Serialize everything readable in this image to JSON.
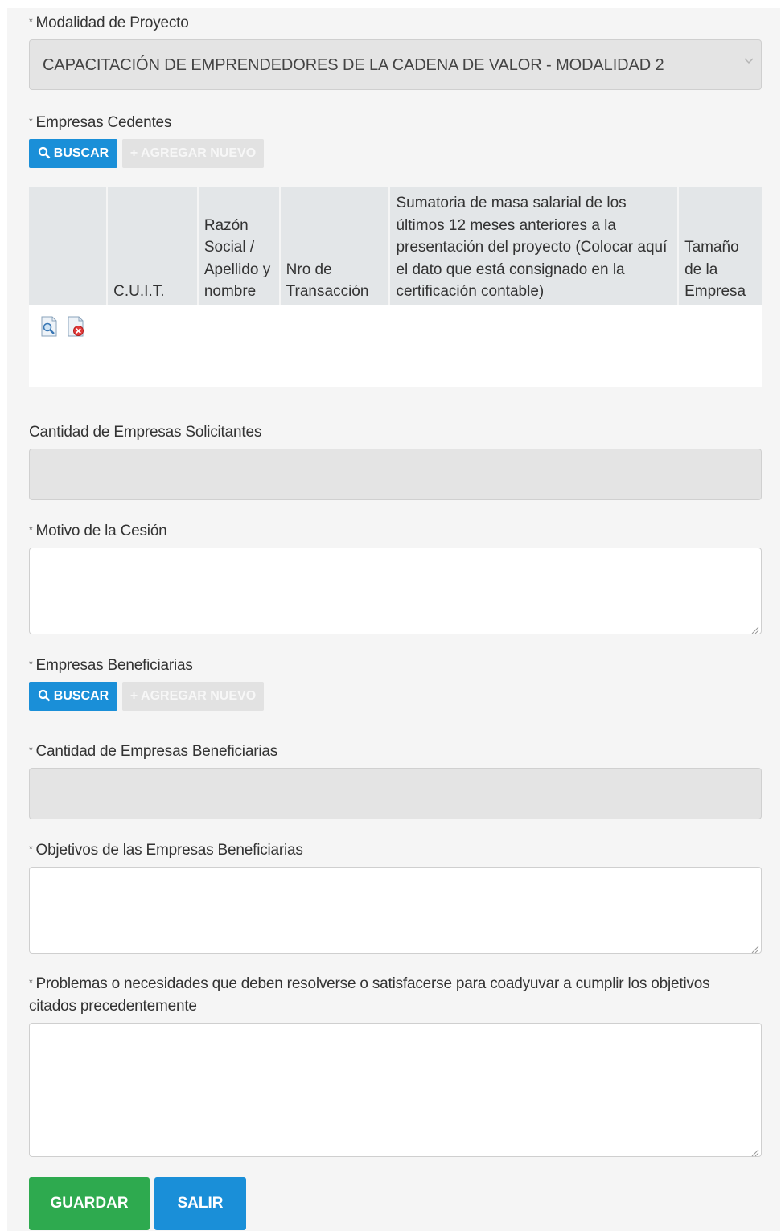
{
  "modalidad": {
    "label": "Modalidad de Proyecto",
    "value": "CAPACITACIÓN DE EMPRENDEDORES DE LA CADENA DE VALOR - MODALIDAD 2"
  },
  "cedentes": {
    "label": "Empresas Cedentes",
    "search_label": "BUSCAR",
    "add_label": "+ AGREGAR NUEVO",
    "columns": [
      "",
      "C.U.I.T.",
      "Razón Social / Apellido y nombre",
      "Nro de Transacción",
      "Sumatoria de masa salarial de los últimos 12 meses anteriores a la presentación del proyecto (Colocar aquí el dato que está consignado en la certificación contable)",
      "Tamaño de la Empresa"
    ]
  },
  "cantidad_solicitantes": {
    "label": "Cantidad de Empresas Solicitantes"
  },
  "motivo": {
    "label": "Motivo de la Cesión"
  },
  "beneficiarias": {
    "label": "Empresas Beneficiarias",
    "search_label": "BUSCAR",
    "add_label": "+ AGREGAR NUEVO"
  },
  "cantidad_beneficiarias": {
    "label": "Cantidad de Empresas Beneficiarias"
  },
  "objetivos": {
    "label": "Objetivos de las Empresas Beneficiarias"
  },
  "problemas": {
    "label_line1": "Problemas o necesidades que deben resolverse o satisfacerse para coadyuvar a cumplir los objetivos",
    "label_line2": "citados precedentemente"
  },
  "actions": {
    "save_label": "GUARDAR",
    "exit_label": "SALIR"
  },
  "colors": {
    "primary": "#1a8fd8",
    "success": "#2eaa4f"
  },
  "icons": [
    "search-icon",
    "view-document-icon",
    "delete-document-icon",
    "chevron-down-icon",
    "resize-grip-icon"
  ]
}
